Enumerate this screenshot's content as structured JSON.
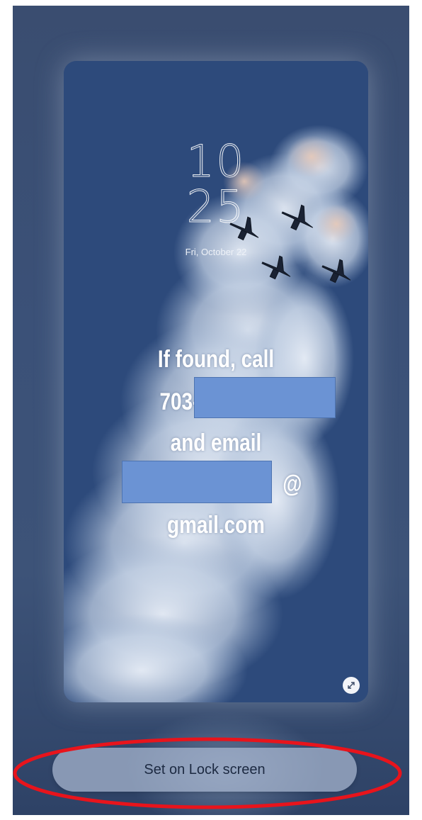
{
  "lock_screen_preview": {
    "clock_hour": "10",
    "clock_minute": "25",
    "date": "Fri, October 22",
    "owner_info": {
      "line1": "If found, call",
      "line2_prefix": "703-",
      "line3": "and email",
      "line4_suffix": "@",
      "line5": "gmail.com"
    },
    "expand_icon": "expand-arrows-icon"
  },
  "actions": {
    "set_lock_screen_label": "Set on Lock screen"
  },
  "colors": {
    "background": "#3b5178",
    "sky": "#2d4a7b",
    "redaction": "#6b93d4",
    "annotation": "#e8141c"
  }
}
